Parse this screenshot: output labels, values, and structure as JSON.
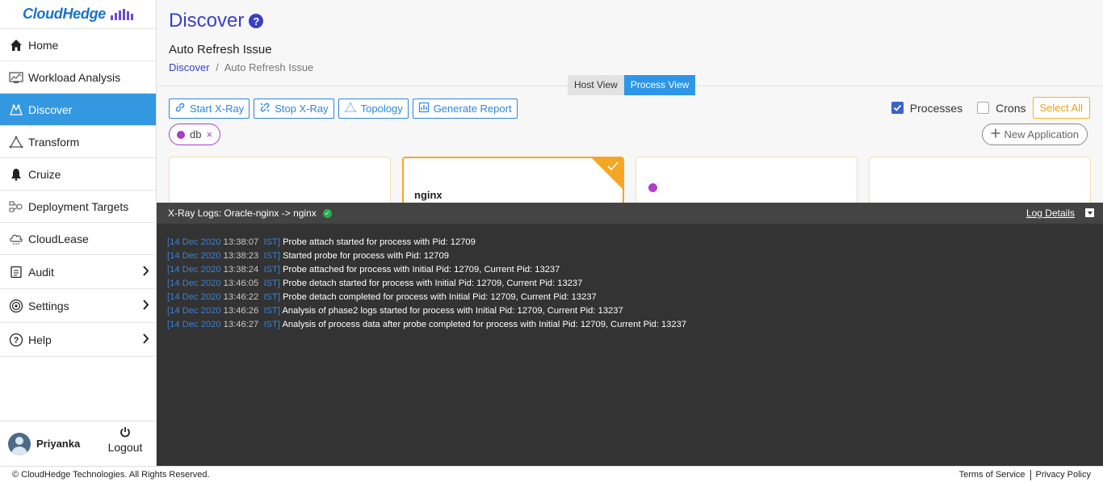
{
  "brand": {
    "name": "CloudHedge"
  },
  "sidebar": {
    "items": [
      {
        "label": "Home",
        "icon": "home-icon"
      },
      {
        "label": "Workload Analysis",
        "icon": "analysis-icon"
      },
      {
        "label": "Discover",
        "icon": "discover-icon",
        "active": true
      },
      {
        "label": "Transform",
        "icon": "transform-icon"
      },
      {
        "label": "Cruize",
        "icon": "cruize-icon"
      },
      {
        "label": "Deployment Targets",
        "icon": "deployment-icon"
      },
      {
        "label": "CloudLease",
        "icon": "cloudlease-icon"
      },
      {
        "label": "Audit",
        "icon": "audit-icon"
      },
      {
        "label": "Settings",
        "icon": "settings-icon"
      },
      {
        "label": "Help",
        "icon": "help-icon"
      }
    ],
    "user": {
      "name": "Priyanka",
      "logout_label": "Logout"
    }
  },
  "header": {
    "title": "Discover",
    "subtitle": "Auto Refresh Issue",
    "breadcrumb": {
      "root": "Discover",
      "separator": "/",
      "current": "Auto Refresh Issue"
    }
  },
  "view_toggle": {
    "host": "Host View",
    "process": "Process View",
    "selected": "Process View"
  },
  "toolbar": {
    "start_xray": "Start X-Ray",
    "stop_xray": "Stop X-Ray",
    "topology": "Topology",
    "generate_report": "Generate Report"
  },
  "filter_chip": {
    "label": "db",
    "remove": "×"
  },
  "filters": {
    "processes_label": "Processes",
    "processes_checked": true,
    "crons_label": "Crons",
    "crons_checked": false,
    "select_all": "Select All",
    "new_application": "New Application"
  },
  "cards": [
    {
      "title": ""
    },
    {
      "title": "nginx",
      "selected": true
    },
    {
      "title": ""
    },
    {
      "title": ""
    }
  ],
  "log_panel": {
    "title": "X-Ray Logs: Oracle-nginx -> nginx",
    "details_label": "Log Details",
    "entries": [
      {
        "date": "[14 Dec 2020",
        "time": "13:38:07",
        "tz": "IST]",
        "message": "Probe attach started for process with Pid: 12709"
      },
      {
        "date": "[14 Dec 2020",
        "time": "13:38:23",
        "tz": "IST]",
        "message": "Started probe for process with Pid: 12709"
      },
      {
        "date": "[14 Dec 2020",
        "time": "13:38:24",
        "tz": "IST]",
        "message": "Probe attached for process with Initial Pid: 12709, Current Pid: 13237"
      },
      {
        "date": "[14 Dec 2020",
        "time": "13:46:05",
        "tz": "IST]",
        "message": "Probe detach started for process with Initial Pid: 12709, Current Pid: 13237"
      },
      {
        "date": "[14 Dec 2020",
        "time": "13:46:22",
        "tz": "IST]",
        "message": "Probe detach completed for process with Initial Pid: 12709, Current Pid: 13237"
      },
      {
        "date": "[14 Dec 2020",
        "time": "13:46:26",
        "tz": "IST]",
        "message": "Analysis of phase2 logs started for process with Initial Pid: 12709, Current Pid: 13237"
      },
      {
        "date": "[14 Dec 2020",
        "time": "13:46:27",
        "tz": "IST]",
        "message": "Analysis of process data after probe completed for process with Initial Pid: 12709, Current Pid: 13237"
      }
    ]
  },
  "footer": {
    "copyright": "© CloudHedge Technologies. All Rights Reserved.",
    "terms": "Terms of Service",
    "privacy": "Privacy Policy"
  },
  "colors": {
    "accent": "#3498e0",
    "title": "#3a3fc6",
    "selected_card": "#f5a623",
    "chip": "#a83ec4",
    "log_bg": "#333333"
  }
}
